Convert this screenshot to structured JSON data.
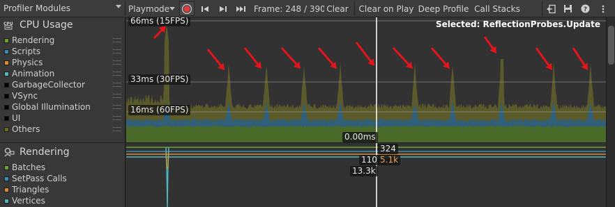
{
  "toolbar": {
    "modules_label": "Profiler Modules",
    "playmode_label": "Playmode",
    "frame_label": "Frame: 248 / 390",
    "clear_label": "Clear",
    "clear_on_play_label": "Clear on Play",
    "deep_profile_label": "Deep Profile",
    "call_stacks_label": "Call Stacks",
    "record_color": "#e0393e"
  },
  "cpu_module": {
    "title": "CPU Usage",
    "icon": "cpu-icon",
    "items": [
      {
        "label": "Rendering",
        "color": "#6ca32e"
      },
      {
        "label": "Scripts",
        "color": "#3a8fb8"
      },
      {
        "label": "Physics",
        "color": "#e08a2a"
      },
      {
        "label": "Animation",
        "color": "#4fb8c0"
      },
      {
        "label": "GarbageCollector",
        "color": "#000000"
      },
      {
        "label": "VSync",
        "color": "#000000"
      },
      {
        "label": "Global Illumination",
        "color": "#000000"
      },
      {
        "label": "UI",
        "color": "#000000"
      },
      {
        "label": "Others",
        "color": "#6c6a22"
      }
    ]
  },
  "rendering_module": {
    "title": "Rendering",
    "icon": "rendering-icon",
    "items": [
      {
        "label": "Batches",
        "color": "#6ca32e"
      },
      {
        "label": "SetPass Calls",
        "color": "#3a8fb8"
      },
      {
        "label": "Triangles",
        "color": "#e08a2a"
      },
      {
        "label": "Vertices",
        "color": "#4fb8c0"
      }
    ]
  },
  "chart": {
    "selected_text": "Selected: ReflectionProbes.Update",
    "line_66": "66ms (15FPS)",
    "line_33": "33ms (30FPS)",
    "line_16": "16ms (60FPS)",
    "cursor_value": "0.00ms"
  },
  "chart2": {
    "v_324": "324",
    "v_110": "110",
    "v_5k": "5.1k",
    "v_13k": "13.3k"
  },
  "colors": {
    "others_fill": "#5b5a2a",
    "scripts_fill": "#2f5f7a",
    "rendering_fill": "#4a6a2a",
    "arrow": "#e3141b"
  }
}
